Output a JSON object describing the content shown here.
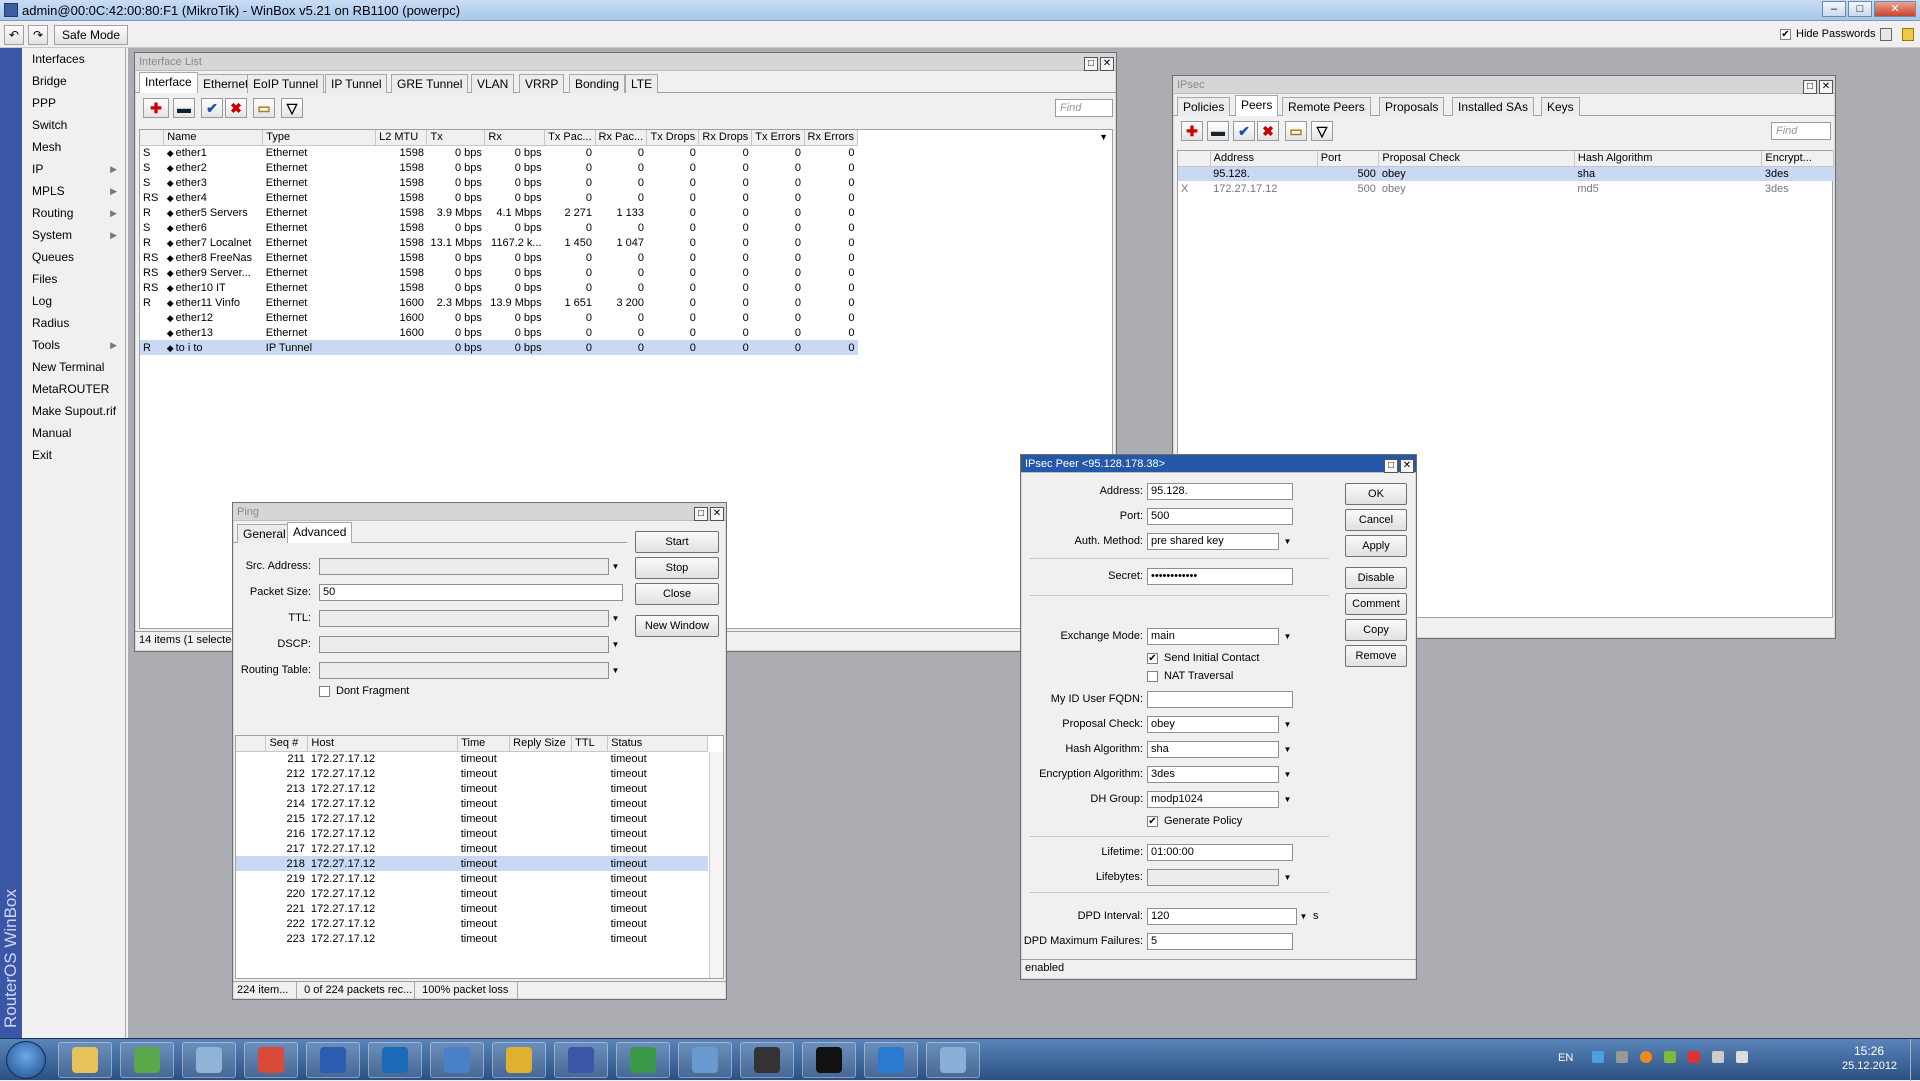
{
  "titlebar": {
    "title": "admin@00:0C:42:00:80:F1 (MikroTik) - WinBox v5.21 on RB1100 (powerpc)"
  },
  "toolbar": {
    "undo": "↶",
    "redo": "↷",
    "safe_mode": "Safe Mode",
    "hide_passwords": "Hide Passwords"
  },
  "sidebar": {
    "brand": "RouterOS WinBox",
    "items": [
      {
        "label": "Interfaces",
        "sub": false
      },
      {
        "label": "Bridge",
        "sub": false
      },
      {
        "label": "PPP",
        "sub": false
      },
      {
        "label": "Switch",
        "sub": false
      },
      {
        "label": "Mesh",
        "sub": false
      },
      {
        "label": "IP",
        "sub": true
      },
      {
        "label": "MPLS",
        "sub": true
      },
      {
        "label": "Routing",
        "sub": true
      },
      {
        "label": "System",
        "sub": true
      },
      {
        "label": "Queues",
        "sub": false
      },
      {
        "label": "Files",
        "sub": false
      },
      {
        "label": "Log",
        "sub": false
      },
      {
        "label": "Radius",
        "sub": false
      },
      {
        "label": "Tools",
        "sub": true
      },
      {
        "label": "New Terminal",
        "sub": false
      },
      {
        "label": "MetaROUTER",
        "sub": false
      },
      {
        "label": "Make Supout.rif",
        "sub": false
      },
      {
        "label": "Manual",
        "sub": false
      },
      {
        "label": "Exit",
        "sub": false
      }
    ]
  },
  "iflist": {
    "title": "Interface List",
    "tabs": [
      "Interface",
      "Ethernet",
      "EoIP Tunnel",
      "IP Tunnel",
      "GRE Tunnel",
      "VLAN",
      "VRRP",
      "Bonding",
      "LTE"
    ],
    "find": "Find",
    "columns": [
      "",
      "Name",
      "Type",
      "L2 MTU",
      "Tx",
      "Rx",
      "Tx Pac...",
      "Rx Pac...",
      "Tx Drops",
      "Rx Drops",
      "Tx Errors",
      "Rx Errors"
    ],
    "rows": [
      [
        "S",
        "ether1",
        "Ethernet",
        "1598",
        "0 bps",
        "0 bps",
        "0",
        "0",
        "0",
        "0",
        "0",
        "0"
      ],
      [
        "S",
        "ether2",
        "Ethernet",
        "1598",
        "0 bps",
        "0 bps",
        "0",
        "0",
        "0",
        "0",
        "0",
        "0"
      ],
      [
        "S",
        "ether3",
        "Ethernet",
        "1598",
        "0 bps",
        "0 bps",
        "0",
        "0",
        "0",
        "0",
        "0",
        "0"
      ],
      [
        "RS",
        "ether4",
        "Ethernet",
        "1598",
        "0 bps",
        "0 bps",
        "0",
        "0",
        "0",
        "0",
        "0",
        "0"
      ],
      [
        "R",
        "ether5 Servers",
        "Ethernet",
        "1598",
        "3.9 Mbps",
        "4.1 Mbps",
        "2 271",
        "1 133",
        "0",
        "0",
        "0",
        "0"
      ],
      [
        "S",
        "ether6",
        "Ethernet",
        "1598",
        "0 bps",
        "0 bps",
        "0",
        "0",
        "0",
        "0",
        "0",
        "0"
      ],
      [
        "R",
        "ether7 Localnet",
        "Ethernet",
        "1598",
        "13.1 Mbps",
        "1167.2 k...",
        "1 450",
        "1 047",
        "0",
        "0",
        "0",
        "0"
      ],
      [
        "RS",
        "ether8 FreeNas",
        "Ethernet",
        "1598",
        "0 bps",
        "0 bps",
        "0",
        "0",
        "0",
        "0",
        "0",
        "0"
      ],
      [
        "RS",
        "ether9 Server...",
        "Ethernet",
        "1598",
        "0 bps",
        "0 bps",
        "0",
        "0",
        "0",
        "0",
        "0",
        "0"
      ],
      [
        "RS",
        "ether10 IT",
        "Ethernet",
        "1598",
        "0 bps",
        "0 bps",
        "0",
        "0",
        "0",
        "0",
        "0",
        "0"
      ],
      [
        "R",
        "ether11 Vinfo",
        "Ethernet",
        "1600",
        "2.3 Mbps",
        "13.9 Mbps",
        "1 651",
        "3 200",
        "0",
        "0",
        "0",
        "0"
      ],
      [
        "",
        "ether12",
        "Ethernet",
        "1600",
        "0 bps",
        "0 bps",
        "0",
        "0",
        "0",
        "0",
        "0",
        "0"
      ],
      [
        "",
        "ether13",
        "Ethernet",
        "1600",
        "0 bps",
        "0 bps",
        "0",
        "0",
        "0",
        "0",
        "0",
        "0"
      ],
      [
        "R",
        "to i to",
        "IP Tunnel",
        "",
        "0 bps",
        "0 bps",
        "0",
        "0",
        "0",
        "0",
        "0",
        "0"
      ]
    ],
    "status": "14 items (1 selected)"
  },
  "ipsec": {
    "title": "IPsec",
    "tabs": [
      "Policies",
      "Peers",
      "Remote Peers",
      "Proposals",
      "Installed SAs",
      "Keys"
    ],
    "find": "Find",
    "columns": [
      "",
      "Address",
      "Port",
      "Proposal Check",
      "Hash Algorithm",
      "Encrypt..."
    ],
    "rows": [
      [
        "",
        "95.128.",
        "500",
        "obey",
        "sha",
        "3des"
      ],
      [
        "X",
        "172.27.17.12",
        "500",
        "obey",
        "md5",
        "3des"
      ]
    ]
  },
  "ping": {
    "title": "Ping",
    "tabs": [
      "General",
      "Advanced"
    ],
    "labels": {
      "src": "Src. Address:",
      "size": "Packet Size:",
      "ttl": "TTL:",
      "dscp": "DSCP:",
      "rt": "Routing Table:",
      "df": "Dont Fragment"
    },
    "values": {
      "size": "50"
    },
    "buttons": [
      "Start",
      "Stop",
      "Close",
      "New Window"
    ],
    "columns": [
      "",
      "Seq #",
      "Host",
      "Time",
      "Reply Size",
      "TTL",
      "Status"
    ],
    "rows": [
      [
        "211",
        "172.27.17.12",
        "timeout",
        "timeout"
      ],
      [
        "212",
        "172.27.17.12",
        "timeout",
        "timeout"
      ],
      [
        "213",
        "172.27.17.12",
        "timeout",
        "timeout"
      ],
      [
        "214",
        "172.27.17.12",
        "timeout",
        "timeout"
      ],
      [
        "215",
        "172.27.17.12",
        "timeout",
        "timeout"
      ],
      [
        "216",
        "172.27.17.12",
        "timeout",
        "timeout"
      ],
      [
        "217",
        "172.27.17.12",
        "timeout",
        "timeout"
      ],
      [
        "218",
        "172.27.17.12",
        "timeout",
        "timeout"
      ],
      [
        "219",
        "172.27.17.12",
        "timeout",
        "timeout"
      ],
      [
        "220",
        "172.27.17.12",
        "timeout",
        "timeout"
      ],
      [
        "221",
        "172.27.17.12",
        "timeout",
        "timeout"
      ],
      [
        "222",
        "172.27.17.12",
        "timeout",
        "timeout"
      ],
      [
        "223",
        "172.27.17.12",
        "timeout",
        "timeout"
      ]
    ],
    "status": [
      "224 item...",
      "0 of 224 packets rec...",
      "100% packet loss"
    ]
  },
  "peer": {
    "title": "IPsec Peer <95.128.178.38>",
    "labels": {
      "address": "Address:",
      "port": "Port:",
      "auth": "Auth. Method:",
      "secret": "Secret:",
      "exmode": "Exchange Mode:",
      "sic": "Send Initial Contact",
      "nat": "NAT Traversal",
      "myid": "My ID User FQDN:",
      "pc": "Proposal Check:",
      "hash": "Hash Algorithm:",
      "enc": "Encryption Algorithm:",
      "dh": "DH Group:",
      "gp": "Generate Policy",
      "life": "Lifetime:",
      "lifeb": "Lifebytes:",
      "dpd": "DPD Interval:",
      "dpdmax": "DPD Maximum Failures:",
      "unit_s": "s"
    },
    "values": {
      "address": "95.128.",
      "port": "500",
      "auth": "pre shared key",
      "secret": "••••••••••••",
      "exmode": "main",
      "myid": "",
      "pc": "obey",
      "hash": "sha",
      "enc": "3des",
      "dh": "modp1024",
      "life": "01:00:00",
      "lifeb": "",
      "dpd": "120",
      "dpdmax": "5"
    },
    "buttons": [
      "OK",
      "Cancel",
      "Apply",
      "Disable",
      "Comment",
      "Copy",
      "Remove"
    ],
    "status": "enabled"
  },
  "taskbar": {
    "lang": "EN",
    "time": "15:26",
    "date": "25.12.2012",
    "apps": [
      "explorer",
      "network",
      "tools",
      "chrome",
      "mail",
      "outlook",
      "app",
      "manager",
      "winbox",
      "globe",
      "folder",
      "3cx",
      "cmd",
      "phone",
      "window"
    ]
  },
  "colors": {
    "accent": "#2458a8",
    "selection": "#c9d9f4",
    "sidebar": "#3c56a6"
  }
}
